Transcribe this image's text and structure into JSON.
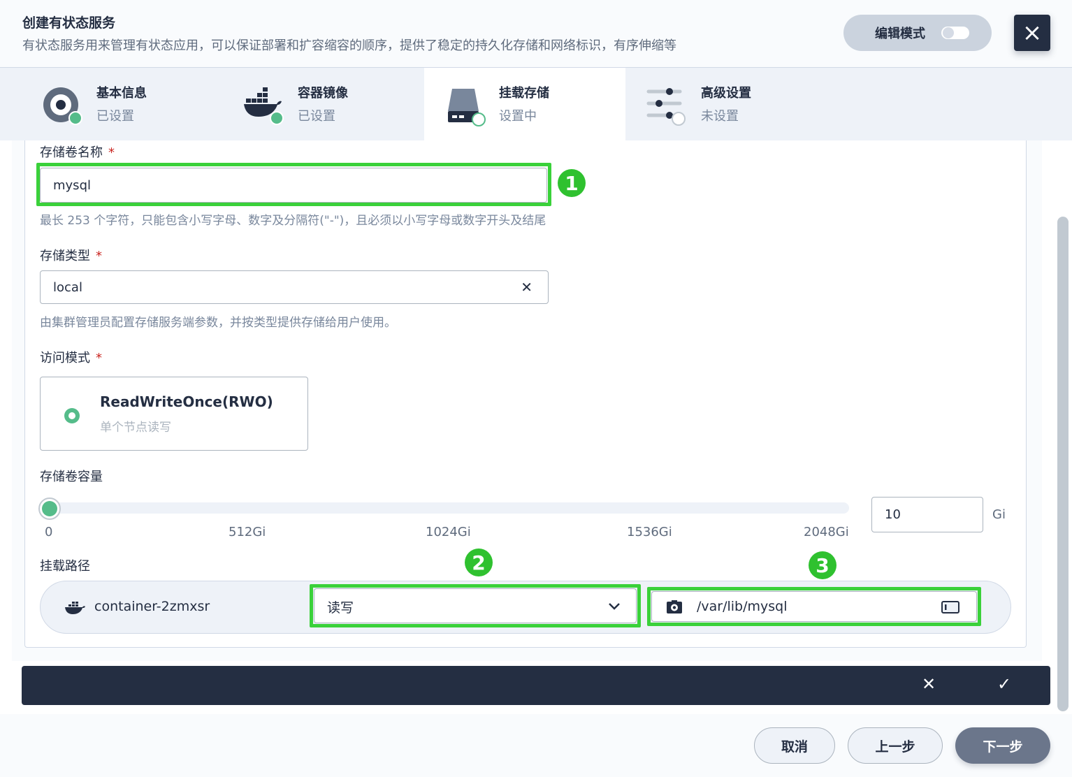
{
  "header": {
    "title": "创建有状态服务",
    "subtitle": "有状态服务用来管理有状态应用，可以保证部署和扩容缩容的顺序，提供了稳定的持久化存储和网络标识，有序伸缩等",
    "edit_mode_label": "编辑模式",
    "edit_mode_on": false,
    "close_icon": "×"
  },
  "steps": [
    {
      "name": "基本信息",
      "status": "已设置",
      "icon": "disk-icon",
      "state": "done"
    },
    {
      "name": "容器镜像",
      "status": "已设置",
      "icon": "docker-icon",
      "state": "done"
    },
    {
      "name": "挂载存储",
      "status": "设置中",
      "icon": "storage-icon",
      "state": "active"
    },
    {
      "name": "高级设置",
      "status": "未设置",
      "icon": "sliders-icon",
      "state": "todo"
    }
  ],
  "form": {
    "volume_name_label": "存储卷名称",
    "required_mark": "*",
    "volume_name_value": "mysql",
    "volume_name_hint": "最长 253 个字符，只能包含小写字母、数字及分隔符(\"-\")，且必须以小写字母或数字开头及结尾",
    "storage_type_label": "存储类型",
    "storage_type_value": "local",
    "storage_type_clear": "✕",
    "storage_type_hint": "由集群管理员配置存储服务端参数，并按类型提供存储给用户使用。",
    "access_mode_label": "访问模式",
    "access_mode_name": "ReadWriteOnce(RWO)",
    "access_mode_desc": "单个节点读写",
    "capacity_label": "存储卷容量",
    "capacity_ticks": [
      "0",
      "512Gi",
      "1024Gi",
      "1536Gi",
      "2048Gi"
    ],
    "capacity_value": "10",
    "capacity_unit": "Gi",
    "mount_path_label": "挂载路径",
    "container_name": "container-2zmxsr",
    "mount_mode": "读写",
    "mount_path": "/var/lib/mysql"
  },
  "annotations": [
    "1",
    "2",
    "3"
  ],
  "action_bar": {
    "cancel_icon": "✕",
    "confirm_icon": "✓"
  },
  "footer": {
    "cancel": "取消",
    "prev": "上一步",
    "next": "下一步"
  },
  "colors": {
    "accent_green": "#55bc8a",
    "highlight_green": "#3ad13a",
    "dark": "#242e42"
  }
}
